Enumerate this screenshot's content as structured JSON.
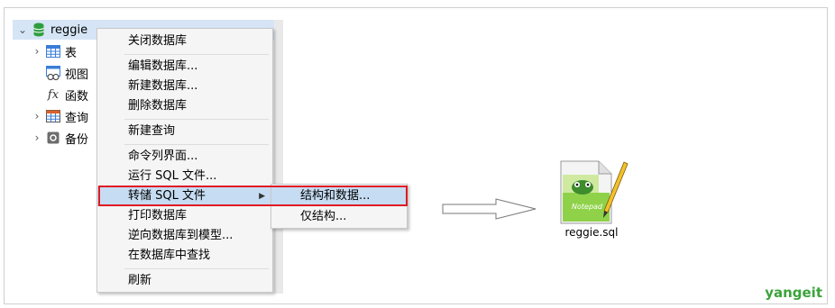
{
  "tree": {
    "database": "reggie",
    "items": [
      {
        "label": "表",
        "icon": "table-icon",
        "expandable": true
      },
      {
        "label": "视图",
        "icon": "view-icon",
        "expandable": false
      },
      {
        "label": "函数",
        "icon": "function-icon",
        "expandable": false
      },
      {
        "label": "查询",
        "icon": "query-icon",
        "expandable": true
      },
      {
        "label": "备份",
        "icon": "backup-icon",
        "expandable": true
      }
    ]
  },
  "context_menu": {
    "items": [
      "关闭数据库",
      "编辑数据库...",
      "新建数据库...",
      "删除数据库",
      "新建查询",
      "命令列界面...",
      "运行 SQL 文件...",
      "转储 SQL 文件",
      "打印数据库",
      "逆向数据库到模型...",
      "在数据库中查找",
      "刷新"
    ],
    "highlighted": "转储 SQL 文件"
  },
  "submenu": {
    "items": [
      "结构和数据...",
      "仅结构..."
    ],
    "highlighted": "结构和数据..."
  },
  "output_file": {
    "name": "reggie.sql",
    "icon": "notepad-plus-plus-file-icon"
  },
  "watermark": "yangeit",
  "colors": {
    "highlight": "#c6dcf2",
    "callout": "#e01b24",
    "brand": "#3aa43a"
  }
}
